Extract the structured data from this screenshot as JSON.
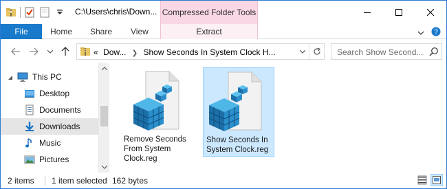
{
  "window": {
    "title_path": "C:\\Users\\chris\\Down...",
    "context_group": "Compressed Folder Tools"
  },
  "ribbon": {
    "file": "File",
    "home": "Home",
    "share": "Share",
    "view": "View",
    "extract": "Extract"
  },
  "address": {
    "overflow": "«",
    "crumbs": [
      "Dow...",
      "Show Seconds In System Clock H..."
    ]
  },
  "search": {
    "placeholder": "Search Show Second..."
  },
  "nav": {
    "items": [
      {
        "label": "This PC",
        "icon": "this-pc-icon"
      },
      {
        "label": "Desktop",
        "icon": "desktop-folder-icon"
      },
      {
        "label": "Documents",
        "icon": "documents-folder-icon"
      },
      {
        "label": "Downloads",
        "icon": "downloads-folder-icon",
        "selected": true
      },
      {
        "label": "Music",
        "icon": "music-folder-icon"
      },
      {
        "label": "Pictures",
        "icon": "pictures-folder-icon"
      }
    ]
  },
  "files": [
    {
      "name": "Remove Seconds From System Clock.reg",
      "icon": "registry-file-icon",
      "selected": false
    },
    {
      "name": "Show Seconds In System Clock.reg",
      "icon": "registry-file-icon",
      "selected": true
    }
  ],
  "status": {
    "items_count": "2 items",
    "selection": "1 item selected",
    "size": "162 bytes"
  },
  "colors": {
    "accent": "#1979ca",
    "context_tab": "#f9d7e4",
    "selection_fill": "#cce8ff",
    "selection_border": "#99d1ff"
  }
}
